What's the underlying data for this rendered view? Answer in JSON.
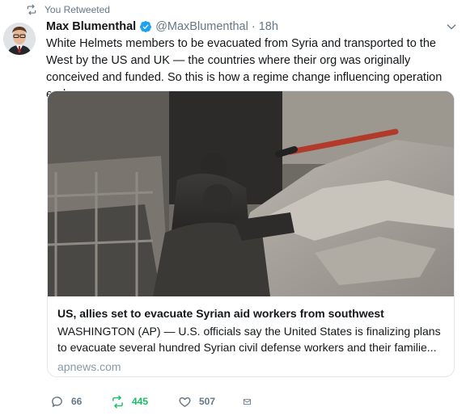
{
  "context": {
    "retweeted_label": "You Retweeted",
    "icon": "retweet-icon"
  },
  "author": {
    "name": "Max Blumenthal",
    "verified": true,
    "handle": "@MaxBlumenthal",
    "separator": "·",
    "time": "18h"
  },
  "tweet": {
    "text": "White Helmets members to be evacuated from Syria and transported to the West by the US and UK — the countries where their org was originally conceived and funded. So this is how a regime change influencing operation ends."
  },
  "card": {
    "title": "US, allies set to evacuate Syrian aid workers from southwest",
    "description": "WASHINGTON (AP) — U.S. officials say the United States is finalizing plans to evacuate several hundred Syrian civil defense workers and their familie...",
    "domain": "apnews.com"
  },
  "actions": {
    "replies": "66",
    "retweets": "445",
    "likes": "507"
  },
  "colors": {
    "retweet_active": "#17bf63",
    "muted": "#657786",
    "verified_blue": "#1da1f2",
    "border": "#e1e8ed"
  }
}
